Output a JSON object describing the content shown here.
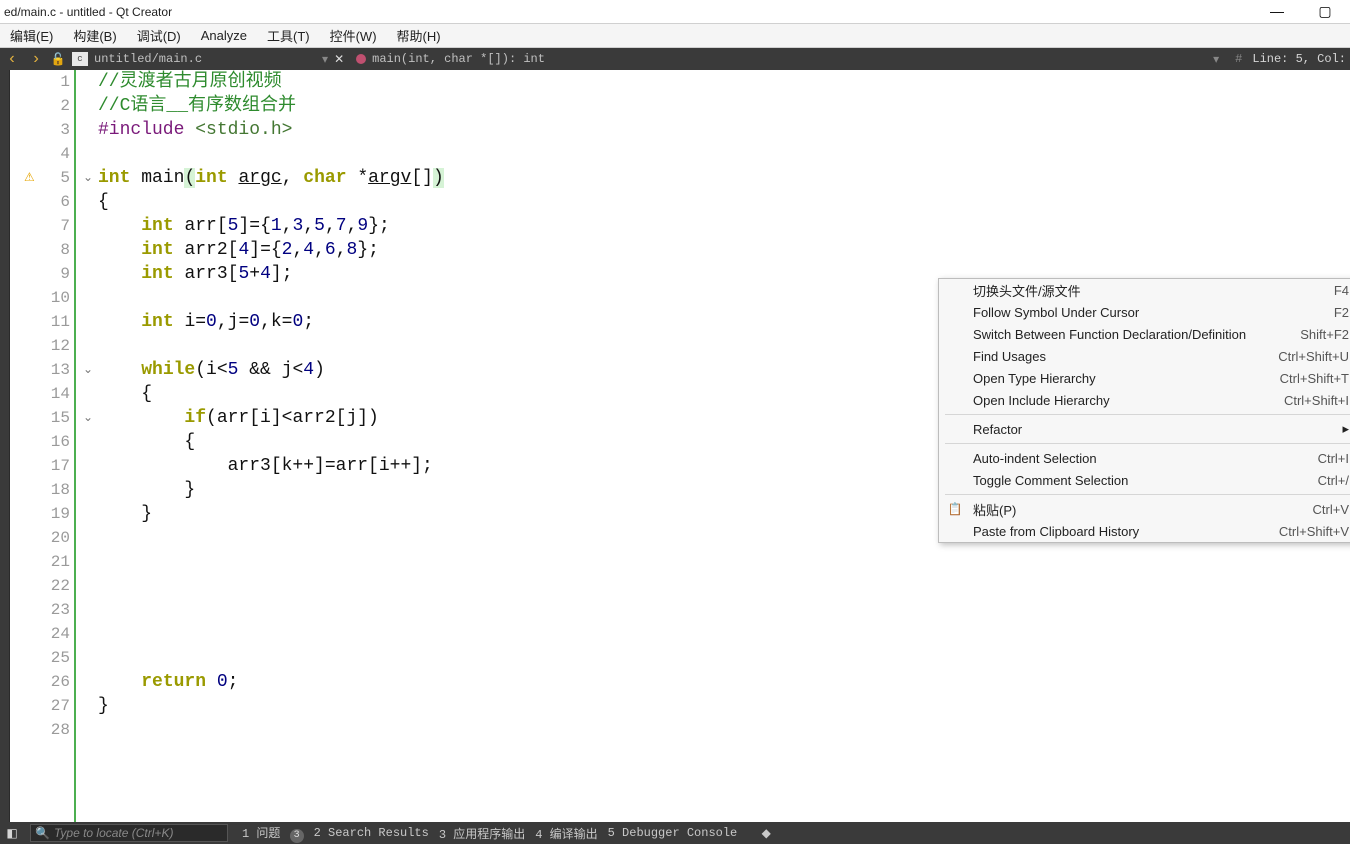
{
  "title": "ed/main.c - untitled - Qt Creator",
  "menu": [
    "编辑(E)",
    "构建(B)",
    "调试(D)",
    "Analyze",
    "工具(T)",
    "控件(W)",
    "帮助(H)"
  ],
  "darkbar": {
    "file_badge": "c",
    "path": "untitled/main.c",
    "func_sig": "main(int, char *[]): int",
    "linecol": "Line: 5, Col:"
  },
  "code": {
    "lines": [
      {
        "n": 1,
        "tokens": [
          {
            "t": "//灵渡者古月原创视频",
            "cls": "tok-comment"
          }
        ]
      },
      {
        "n": 2,
        "tokens": [
          {
            "t": "//C语言__有序数组合并",
            "cls": "tok-comment"
          }
        ]
      },
      {
        "n": 3,
        "tokens": [
          {
            "t": "#include ",
            "cls": "tok-pp"
          },
          {
            "t": "<stdio.h>",
            "cls": "tok-inc"
          }
        ]
      },
      {
        "n": 4,
        "tokens": []
      },
      {
        "n": 5,
        "fold": true,
        "warn": true,
        "tokens": [
          {
            "t": "int ",
            "cls": "tok-kw"
          },
          {
            "t": "main",
            "cls": ""
          },
          {
            "t": "(",
            "cls": "tok-hl"
          },
          {
            "t": "int ",
            "cls": "tok-kw"
          },
          {
            "t": "argc",
            "cls": "tok-ul"
          },
          {
            "t": ", ",
            "cls": ""
          },
          {
            "t": "char ",
            "cls": "tok-kw"
          },
          {
            "t": "*",
            "cls": ""
          },
          {
            "t": "argv",
            "cls": "tok-ul"
          },
          {
            "t": "[]",
            "cls": ""
          },
          {
            "t": ")",
            "cls": "tok-hl"
          }
        ]
      },
      {
        "n": 6,
        "tokens": [
          {
            "t": "{",
            "cls": ""
          }
        ]
      },
      {
        "n": 7,
        "tokens": [
          {
            "t": "    ",
            "cls": ""
          },
          {
            "t": "int ",
            "cls": "tok-kw"
          },
          {
            "t": "arr[",
            "cls": ""
          },
          {
            "t": "5",
            "cls": "tok-num"
          },
          {
            "t": "]={",
            "cls": ""
          },
          {
            "t": "1",
            "cls": "tok-num"
          },
          {
            "t": ",",
            "cls": ""
          },
          {
            "t": "3",
            "cls": "tok-num"
          },
          {
            "t": ",",
            "cls": ""
          },
          {
            "t": "5",
            "cls": "tok-num"
          },
          {
            "t": ",",
            "cls": ""
          },
          {
            "t": "7",
            "cls": "tok-num"
          },
          {
            "t": ",",
            "cls": ""
          },
          {
            "t": "9",
            "cls": "tok-num"
          },
          {
            "t": "};",
            "cls": ""
          }
        ]
      },
      {
        "n": 8,
        "tokens": [
          {
            "t": "    ",
            "cls": ""
          },
          {
            "t": "int ",
            "cls": "tok-kw"
          },
          {
            "t": "arr2[",
            "cls": ""
          },
          {
            "t": "4",
            "cls": "tok-num"
          },
          {
            "t": "]={",
            "cls": ""
          },
          {
            "t": "2",
            "cls": "tok-num"
          },
          {
            "t": ",",
            "cls": ""
          },
          {
            "t": "4",
            "cls": "tok-num"
          },
          {
            "t": ",",
            "cls": ""
          },
          {
            "t": "6",
            "cls": "tok-num"
          },
          {
            "t": ",",
            "cls": ""
          },
          {
            "t": "8",
            "cls": "tok-num"
          },
          {
            "t": "};",
            "cls": ""
          }
        ]
      },
      {
        "n": 9,
        "tokens": [
          {
            "t": "    ",
            "cls": ""
          },
          {
            "t": "int ",
            "cls": "tok-kw"
          },
          {
            "t": "arr3[",
            "cls": ""
          },
          {
            "t": "5",
            "cls": "tok-num"
          },
          {
            "t": "+",
            "cls": ""
          },
          {
            "t": "4",
            "cls": "tok-num"
          },
          {
            "t": "];",
            "cls": ""
          }
        ]
      },
      {
        "n": 10,
        "tokens": []
      },
      {
        "n": 11,
        "tokens": [
          {
            "t": "    ",
            "cls": ""
          },
          {
            "t": "int ",
            "cls": "tok-kw"
          },
          {
            "t": "i=",
            "cls": ""
          },
          {
            "t": "0",
            "cls": "tok-num"
          },
          {
            "t": ",j=",
            "cls": ""
          },
          {
            "t": "0",
            "cls": "tok-num"
          },
          {
            "t": ",k=",
            "cls": ""
          },
          {
            "t": "0",
            "cls": "tok-num"
          },
          {
            "t": ";",
            "cls": ""
          }
        ]
      },
      {
        "n": 12,
        "tokens": []
      },
      {
        "n": 13,
        "fold": true,
        "tokens": [
          {
            "t": "    ",
            "cls": ""
          },
          {
            "t": "while",
            "cls": "tok-kw"
          },
          {
            "t": "(i<",
            "cls": ""
          },
          {
            "t": "5",
            "cls": "tok-num"
          },
          {
            "t": " && j<",
            "cls": ""
          },
          {
            "t": "4",
            "cls": "tok-num"
          },
          {
            "t": ")",
            "cls": ""
          }
        ]
      },
      {
        "n": 14,
        "tokens": [
          {
            "t": "    {",
            "cls": ""
          }
        ]
      },
      {
        "n": 15,
        "fold": true,
        "tokens": [
          {
            "t": "        ",
            "cls": ""
          },
          {
            "t": "if",
            "cls": "tok-kw"
          },
          {
            "t": "(arr[i]<arr2[j])",
            "cls": ""
          }
        ]
      },
      {
        "n": 16,
        "tokens": [
          {
            "t": "        {",
            "cls": ""
          }
        ]
      },
      {
        "n": 17,
        "tokens": [
          {
            "t": "            arr3[k++]=arr[i++];",
            "cls": ""
          }
        ]
      },
      {
        "n": 18,
        "tokens": [
          {
            "t": "        }",
            "cls": ""
          }
        ]
      },
      {
        "n": 19,
        "tokens": [
          {
            "t": "    }",
            "cls": ""
          }
        ]
      },
      {
        "n": 20,
        "tokens": []
      },
      {
        "n": 21,
        "tokens": []
      },
      {
        "n": 22,
        "tokens": []
      },
      {
        "n": 23,
        "tokens": []
      },
      {
        "n": 24,
        "tokens": []
      },
      {
        "n": 25,
        "tokens": []
      },
      {
        "n": 26,
        "tokens": [
          {
            "t": "    ",
            "cls": ""
          },
          {
            "t": "return ",
            "cls": "tok-kw"
          },
          {
            "t": "0",
            "cls": "tok-num"
          },
          {
            "t": ";",
            "cls": ""
          }
        ]
      },
      {
        "n": 27,
        "tokens": [
          {
            "t": "}",
            "cls": ""
          }
        ]
      },
      {
        "n": 28,
        "tokens": []
      }
    ]
  },
  "context_menu": [
    {
      "label": "切换头文件/源文件",
      "shortcut": "F4"
    },
    {
      "label": "Follow Symbol Under Cursor",
      "shortcut": "F2"
    },
    {
      "label": "Switch Between Function Declaration/Definition",
      "shortcut": "Shift+F2"
    },
    {
      "label": "Find Usages",
      "shortcut": "Ctrl+Shift+U"
    },
    {
      "label": "Open Type Hierarchy",
      "shortcut": "Ctrl+Shift+T"
    },
    {
      "label": "Open Include Hierarchy",
      "shortcut": "Ctrl+Shift+I"
    },
    {
      "sep": true
    },
    {
      "label": "Refactor",
      "sub": true
    },
    {
      "sep": true
    },
    {
      "label": "Auto-indent Selection",
      "shortcut": "Ctrl+I"
    },
    {
      "label": "Toggle Comment Selection",
      "shortcut": "Ctrl+/"
    },
    {
      "sep": true
    },
    {
      "label": "粘贴(P)",
      "shortcut": "Ctrl+V",
      "icon": "paste"
    },
    {
      "label": "Paste from Clipboard History",
      "shortcut": "Ctrl+Shift+V"
    }
  ],
  "bottom": {
    "search_placeholder": "Type to locate (Ctrl+K)",
    "tabs": [
      "1 问题",
      "2 Search Results",
      "3 应用程序输出",
      "4 编译输出",
      "5 Debugger Console"
    ],
    "badge": "3"
  }
}
